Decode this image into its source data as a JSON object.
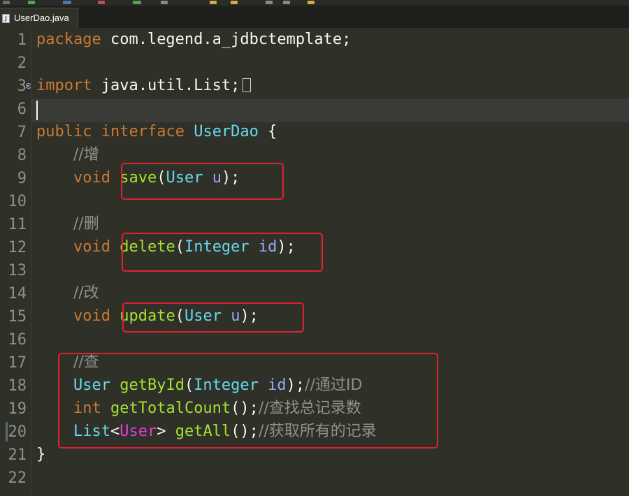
{
  "tab": {
    "title": "UserDao.java",
    "icon": "java-file-icon"
  },
  "gutter": {
    "line_numbers": [
      "1",
      "2",
      "3",
      "6",
      "7",
      "8",
      "9",
      "10",
      "11",
      "12",
      "13",
      "14",
      "15",
      "16",
      "17",
      "18",
      "19",
      "20",
      "21",
      "22"
    ]
  },
  "code": {
    "l1": {
      "kw": "package",
      "rest": " com.legend.a_jdbctemplate;"
    },
    "l3": {
      "kw": "import",
      "rest": " java.util.List;"
    },
    "l7": {
      "kw1": "public",
      "kw2": "interface",
      "name": "UserDao",
      "brace": "{"
    },
    "l8": {
      "comment": "//增"
    },
    "l9": {
      "kw": "void",
      "fn": "save",
      "open": "(",
      "type": "User",
      "param": "u",
      "close": ");"
    },
    "l11": {
      "comment": "//删"
    },
    "l12": {
      "kw": "void",
      "fn": "delete",
      "open": "(",
      "type": "Integer",
      "param": "id",
      "close": ");"
    },
    "l14": {
      "comment": "//改"
    },
    "l15": {
      "kw": "void",
      "fn": "update",
      "open": "(",
      "type": "User",
      "param": "u",
      "close": ");"
    },
    "l17": {
      "comment": "//查"
    },
    "l18": {
      "type": "User",
      "fn": "getById",
      "open": "(",
      "ptype": "Integer",
      "param": "id",
      "close": ");",
      "comment": "//通过ID"
    },
    "l19": {
      "kw": "int",
      "fn": "getTotalCount",
      "paren": "();",
      "comment": "//查找总记录数"
    },
    "l20": {
      "type": "List",
      "lt": "<",
      "generic": "User",
      "gt": ">",
      "fn": "getAll",
      "paren": "();",
      "comment": "//获取所有的记录"
    },
    "l21": {
      "brace": "}"
    }
  },
  "colors": {
    "background": "#2f3129",
    "keyword": "#cc7832",
    "type": "#66d9ef",
    "method": "#a6e22e",
    "parameter": "#9aa6ff",
    "comment": "#8f908a",
    "generic": "#e03ed9",
    "annotation_box": "#e0212f"
  }
}
